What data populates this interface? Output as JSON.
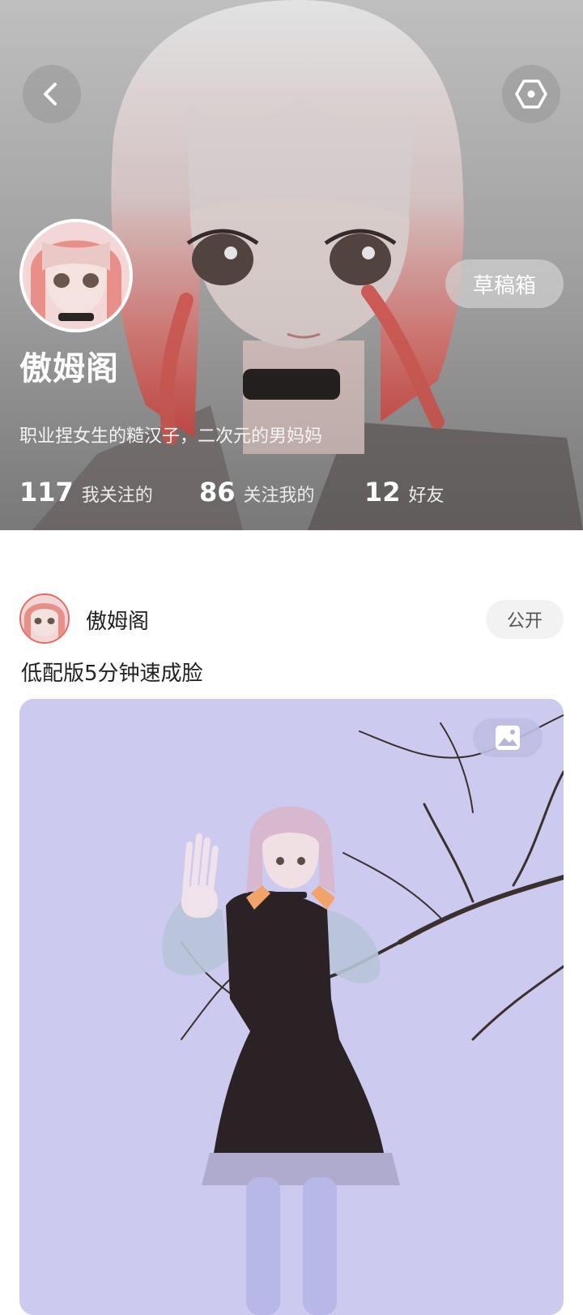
{
  "header": {
    "back_icon": "chevron-left-icon",
    "settings_icon": "hexagon-settings-icon",
    "drafts_label": "草稿箱"
  },
  "profile": {
    "name": "傲姆阁",
    "bio": "职业捏女生的糙汉子，二次元的男妈妈",
    "stats": [
      {
        "count": "117",
        "label": "我关注的"
      },
      {
        "count": "86",
        "label": "关注我的"
      },
      {
        "count": "12",
        "label": "好友"
      }
    ]
  },
  "post": {
    "author": "傲姆阁",
    "visibility": "公开",
    "title": "低配版5分钟速成脸",
    "image_type_icon": "image-icon"
  },
  "colors": {
    "accent_red": "#e76a61",
    "image_bg": "#cccbef",
    "text_dark": "#222222"
  }
}
